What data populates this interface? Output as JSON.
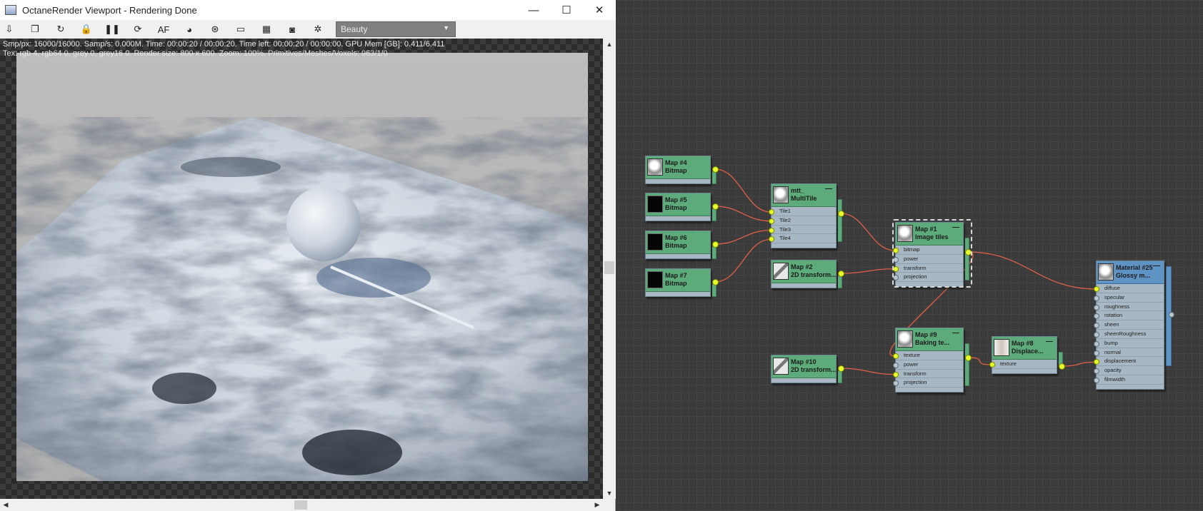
{
  "viewport": {
    "window_title": "OctaneRender Viewport - Rendering Done",
    "window_buttons": {
      "minimize": "—",
      "maximize": "☐",
      "close": "✕"
    },
    "toolbar_icons": [
      {
        "name": "save-render-icon",
        "glyph": "⇩"
      },
      {
        "name": "copy-clipboard-icon",
        "glyph": "❐"
      },
      {
        "name": "restart-render-icon",
        "glyph": "↻"
      },
      {
        "name": "lock-icon",
        "glyph": "🔒"
      },
      {
        "name": "pause-icon",
        "glyph": "❚❚"
      },
      {
        "name": "recompile-icon",
        "glyph": "⟳"
      },
      {
        "name": "autofocus-icon",
        "glyph": "AF"
      },
      {
        "name": "color-picker-icon",
        "glyph": "◕"
      },
      {
        "name": "material-picker-icon",
        "glyph": "⊛"
      },
      {
        "name": "region-render-icon",
        "glyph": "▭"
      },
      {
        "name": "film-region-icon",
        "glyph": "▦"
      },
      {
        "name": "camera-icon",
        "glyph": "◙"
      },
      {
        "name": "settings-icon",
        "glyph": "✲"
      }
    ],
    "render_pass": "Beauty",
    "stats_line1": "Smp/px: 16000/16000.   Samp/s: 0.000M.   Time: 00:00:20 / 00:00:20.   Time left: 00:00:20 / 00:00:00.   GPU Mem [GB]: 0.411/6.411",
    "stats_line2": "Tex: rgb 4, rgb64 0, grey 0, grey16 0.   Render size: 800 x 600.   Zoom: 100%.   Primitives/Meshes/Voxels: 963/1/0",
    "scroll": {
      "up": "▲",
      "down": "▼",
      "left": "◀",
      "right": "▶"
    }
  },
  "node_editor": {
    "nodes": [
      {
        "id": "map4",
        "name": "Map #4",
        "type": "Bitmap",
        "thumb": "marble"
      },
      {
        "id": "map5",
        "name": "Map #5",
        "type": "Bitmap",
        "thumb": "black"
      },
      {
        "id": "map6",
        "name": "Map #6",
        "type": "Bitmap",
        "thumb": "black"
      },
      {
        "id": "map7",
        "name": "Map #7",
        "type": "Bitmap",
        "thumb": "black"
      },
      {
        "id": "mtt",
        "name": "mtt_",
        "type": "MultiTile",
        "thumb": "marble",
        "slots": [
          "Tile1",
          "Tile2",
          "Tile3",
          "Tile4"
        ]
      },
      {
        "id": "map2",
        "name": "Map #2",
        "type": "2D transform...",
        "thumb": "transform"
      },
      {
        "id": "map1",
        "name": "Map #1",
        "type": "Image tiles",
        "thumb": "marble",
        "slots": [
          "bitmap",
          "power",
          "transform",
          "projection"
        ]
      },
      {
        "id": "map10",
        "name": "Map #10",
        "type": "2D transform...",
        "thumb": "transform"
      },
      {
        "id": "map9",
        "name": "Map #9",
        "type": "Baking te...",
        "thumb": "marble",
        "slots": [
          "texture",
          "power",
          "transform",
          "projection"
        ]
      },
      {
        "id": "map8",
        "name": "Map #8",
        "type": "Displace...",
        "thumb": "disp",
        "slots": [
          "texture"
        ]
      },
      {
        "id": "mat25",
        "name": "Material #25",
        "type": "Glossy m...",
        "thumb": "marble",
        "slots": [
          "diffuse",
          "specular",
          "roughness",
          "rotation",
          "sheen",
          "sheenRoughness",
          "bump",
          "normal",
          "displacement",
          "opacity",
          "filmwidth"
        ]
      }
    ],
    "minimize_glyph": "—",
    "colors": {
      "node_header": "#5daa7a",
      "material_header": "#5f93c3",
      "wire": "#e06048",
      "connected_socket": "#e4ff2b"
    }
  }
}
